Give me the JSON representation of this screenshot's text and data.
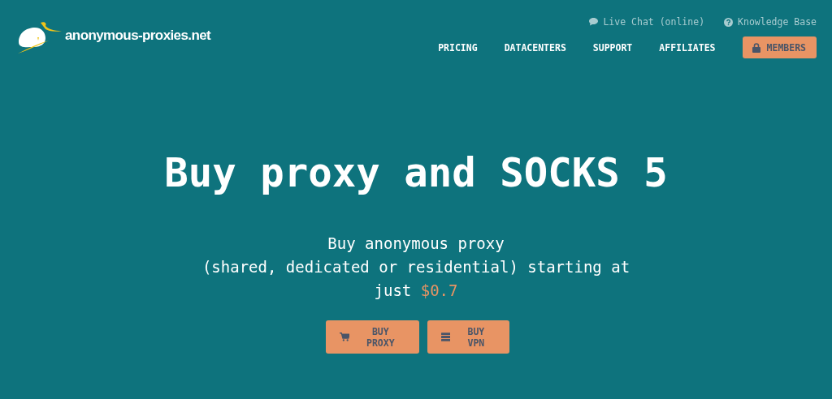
{
  "logo": {
    "text": "anonymous-proxies.net"
  },
  "top_links": [
    {
      "kind": "chat",
      "label": "Live Chat (online)"
    },
    {
      "kind": "help",
      "label": "Knowledge Base"
    }
  ],
  "nav": [
    {
      "label": "PRICING",
      "kind": "link"
    },
    {
      "label": "DATACENTERS",
      "kind": "link"
    },
    {
      "label": "SUPPORT",
      "kind": "link"
    },
    {
      "label": "AFFILIATES",
      "kind": "link"
    },
    {
      "label": "MEMBERS",
      "kind": "button"
    }
  ],
  "hero": {
    "title": "Buy proxy and SOCKS 5",
    "subtitle_lines": [
      "Buy anonymous proxy",
      "(shared, dedicated or residential) starting at",
      "just"
    ],
    "price": "$0.7"
  },
  "buttons": [
    {
      "kind": "cart",
      "label": "BUY PROXY"
    },
    {
      "kind": "server",
      "label": "BUY VPN"
    }
  ]
}
